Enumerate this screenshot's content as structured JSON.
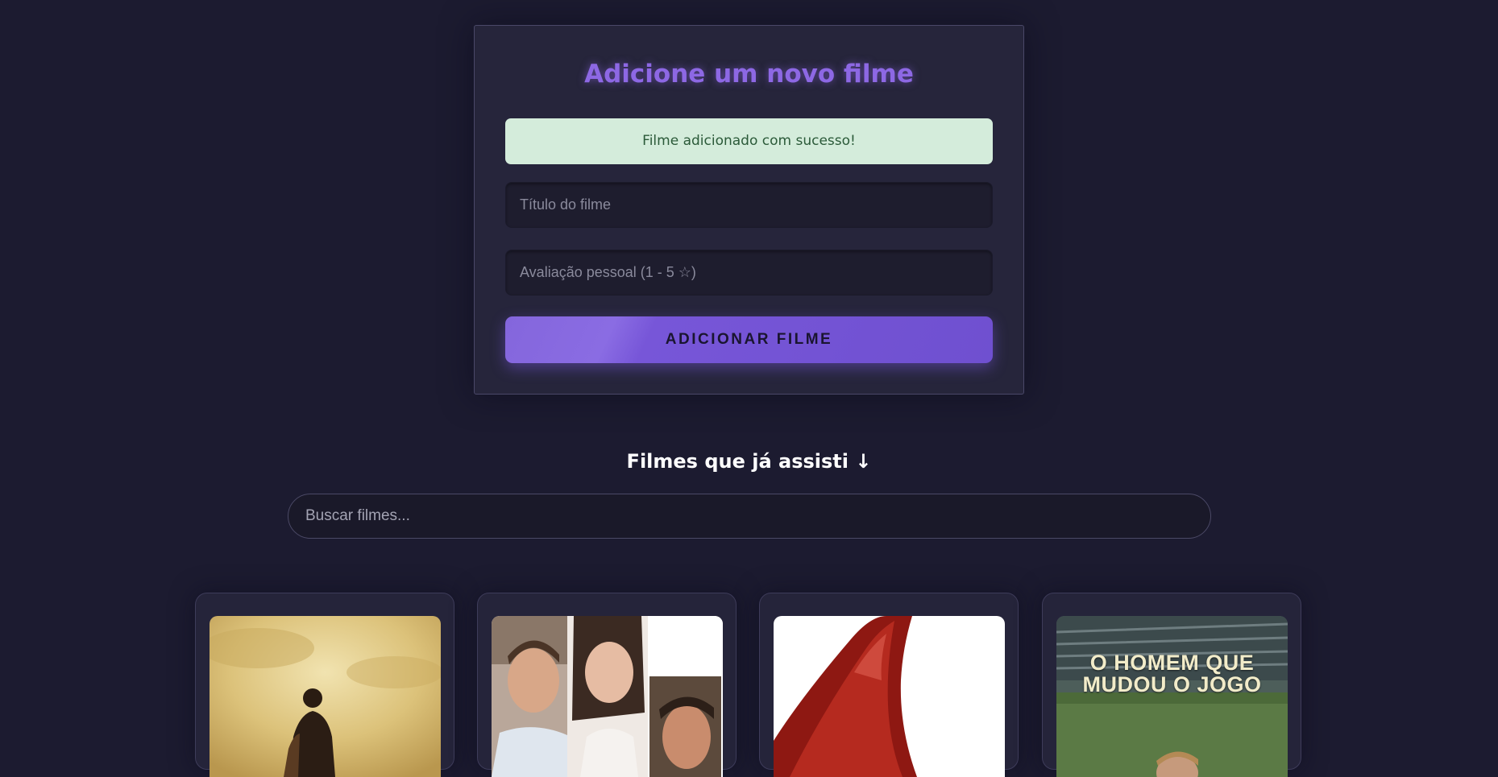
{
  "form": {
    "title": "Adicione um novo filme",
    "success_message": "Filme adicionado com sucesso!",
    "title_placeholder": "Título do filme",
    "rating_placeholder": "Avaliação pessoal (1 - 5 ☆)",
    "submit_label": "ADICIONAR FILME"
  },
  "list": {
    "heading": "Filmes que já assisti ↓",
    "search_placeholder": "Buscar filmes..."
  },
  "posters": [
    {
      "text": ""
    },
    {
      "text": ""
    },
    {
      "text": ""
    },
    {
      "text_line1": "O HOMEM QUE",
      "text_line2": "MUDOU O JOGO"
    }
  ],
  "colors": {
    "background": "#1c1b30",
    "card": "#26253b",
    "accent": "#8d68e4",
    "success_bg": "#d4ecdb",
    "success_text": "#2b5a39"
  }
}
